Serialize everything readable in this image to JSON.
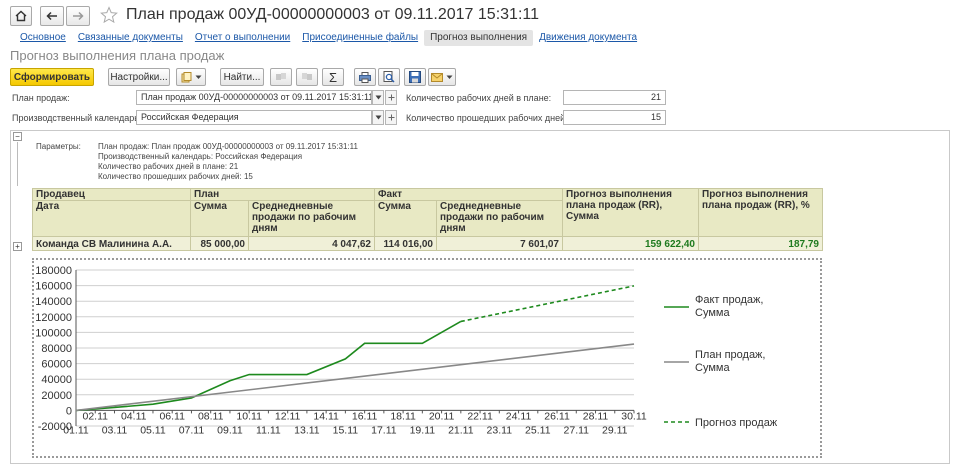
{
  "window": {
    "title": "План продаж 00УД-00000000003 от 09.11.2017 15:31:11"
  },
  "nav": {
    "home_icon": "home-icon",
    "back_icon": "arrow-left-icon",
    "forward_icon": "arrow-right-icon",
    "star_icon": "star-icon"
  },
  "tabs": [
    {
      "label": "Основное"
    },
    {
      "label": "Связанные документы"
    },
    {
      "label": "Отчет о выполнении"
    },
    {
      "label": "Присоединенные файлы"
    },
    {
      "label": "Прогноз выполнения"
    },
    {
      "label": "Движения документа"
    }
  ],
  "page": {
    "subtitle": "Прогноз выполнения плана продаж"
  },
  "toolbar": {
    "generate_label": "Сформировать",
    "settings_label": "Настройки...",
    "find_label": "Найти...",
    "sum_label": "Σ"
  },
  "form": {
    "plan_label": "План продаж:",
    "plan_value": "План продаж 00УД-00000000003 от 09.11.2017 15:31:11",
    "calendar_label": "Производственный календарь:",
    "calendar_value": "Российская Федерация",
    "work_days_label": "Количество рабочих дней в плане:",
    "work_days_value": "21",
    "passed_days_label": "Количество прошедших рабочих дней:",
    "passed_days_value": "15"
  },
  "report": {
    "params_label": "Параметры:",
    "params_lines": [
      "План продаж: План продаж 00УД-00000000003 от 09.11.2017 15:31:11",
      "Производственный календарь: Российская Федерация",
      "Количество рабочих дней в плане: 21",
      "Количество прошедших рабочих дней: 15"
    ],
    "headers": {
      "seller": "Продавец",
      "date": "Дата",
      "plan": "План",
      "plan_sum": "Сумма",
      "plan_avg": "Среднедневные продажи по рабочим дням",
      "fact": "Факт",
      "fact_sum": "Сумма",
      "fact_avg": "Среднедневные продажи по рабочим дням",
      "forecast": "Прогноз выполнения плана продаж (RR), Сумма",
      "forecast_pct": "Прогноз выполнения плана продаж (RR), %"
    },
    "row": {
      "seller": "Команда СВ Малинина А.А.",
      "plan_sum": "85 000,00",
      "plan_avg": "4 047,62",
      "fact_sum": "114 016,00",
      "fact_avg": "7 601,07",
      "forecast": "159 622,40",
      "forecast_pct": "187,79"
    }
  },
  "chart_data": {
    "type": "line",
    "ylim": [
      -20000,
      180000
    ],
    "yticks": [
      "-20000",
      "0",
      "20000",
      "40000",
      "60000",
      "80000",
      "100000",
      "120000",
      "140000",
      "160000",
      "180000"
    ],
    "x_labels_top": [
      "02.11",
      "04.11",
      "06.11",
      "08.11",
      "10.11",
      "12.11",
      "14.11",
      "16.11",
      "18.11",
      "20.11",
      "22.11",
      "24.11",
      "26.11",
      "28.11",
      "30.11"
    ],
    "x_labels_bottom": [
      "01.11",
      "03.11",
      "05.11",
      "07.11",
      "09.11",
      "11.11",
      "13.11",
      "15.11",
      "17.11",
      "19.11",
      "21.11",
      "23.11",
      "25.11",
      "27.11",
      "29.11"
    ],
    "series": [
      {
        "name": "Факт продаж, Сумма",
        "color": "#1e8a1e",
        "style": "solid",
        "x": [
          1,
          3,
          5,
          6,
          7,
          8,
          9,
          10,
          11,
          13,
          15,
          16,
          17,
          18,
          19,
          21
        ],
        "values": [
          0,
          3800,
          8000,
          12000,
          16000,
          27000,
          38000,
          46000,
          46000,
          46000,
          66000,
          86000,
          86000,
          86000,
          86000,
          114016
        ]
      },
      {
        "name": "План продаж, Сумма",
        "color": "#888888",
        "style": "solid",
        "x": [
          1,
          30
        ],
        "values": [
          0,
          85000
        ]
      },
      {
        "name": "Прогноз продаж",
        "color": "#1e8a1e",
        "style": "dashed",
        "x": [
          21,
          30
        ],
        "values": [
          114016,
          159622
        ]
      }
    ]
  }
}
